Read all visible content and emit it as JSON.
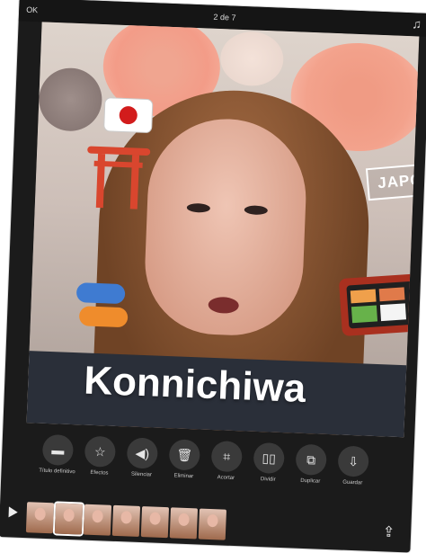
{
  "topbar": {
    "ok_label": "OK",
    "title": "2 de 7",
    "music_icon": "music-note-icon"
  },
  "stickers": {
    "japones_label": "JAPONÉS",
    "caption": "Konnichiwa"
  },
  "toolbar": {
    "items": [
      {
        "label": "Título\ndefinitivo",
        "icon": "speech-bubble-icon"
      },
      {
        "label": "Efectos",
        "icon": "star-icon"
      },
      {
        "label": "Silenciar",
        "icon": "speaker-icon"
      },
      {
        "label": "Eliminar",
        "icon": "trash-icon"
      },
      {
        "label": "Acortar",
        "icon": "crop-icon"
      },
      {
        "label": "Dividir",
        "icon": "split-icon"
      },
      {
        "label": "Duplicar",
        "icon": "duplicate-icon"
      },
      {
        "label": "Guardar",
        "icon": "save-icon"
      }
    ]
  },
  "timeline": {
    "thumb_count": 7,
    "active_index": 1
  }
}
